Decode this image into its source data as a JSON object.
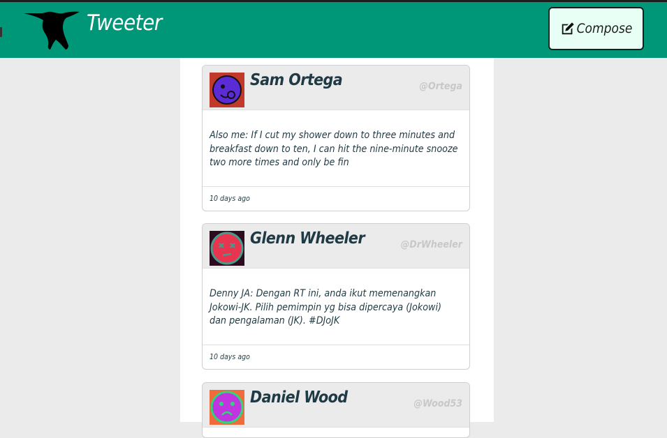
{
  "app": {
    "title": "Tweeter",
    "compose_label": "Compose",
    "colors": {
      "navbar": "#009678",
      "background": "#ebebeb",
      "text": "#1f3a44"
    },
    "icons": {
      "logo": "hummingbird-icon",
      "compose": "edit-icon"
    }
  },
  "tweets": [
    {
      "name": "Sam Ortega",
      "handle": "@Ortega",
      "text": "Also me: If I cut my shower down to three minutes and breakfast down to ten, I can hit the nine-minute snooze two more times and only be fin",
      "time": "10 days ago"
    },
    {
      "name": "Glenn Wheeler",
      "handle": "@DrWheeler",
      "text": "Denny JA: Dengan RT ini, anda ikut memenangkan Jokowi-JK. Pilih pemimpin yg bisa dipercaya (Jokowi) dan pengalaman (JK). #DJoJK",
      "time": "10 days ago"
    },
    {
      "name": "Daniel Wood",
      "handle": "@Wood53",
      "text": "",
      "time": ""
    }
  ]
}
